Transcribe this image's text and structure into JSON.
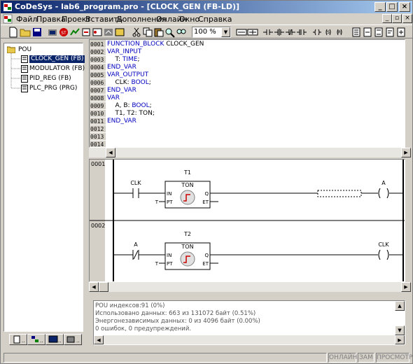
{
  "window": {
    "title": "CoDeSys - lab6_program.pro - [CLOCK_GEN (FB-LD)]",
    "controls": [
      "_",
      "□",
      "×"
    ]
  },
  "menu": [
    "Файл",
    "Правка",
    "Проект",
    "Вставить",
    "Дополнения",
    "Онлайн",
    "Окно",
    "Справка"
  ],
  "toolbar": {
    "zoom": "100 %"
  },
  "tree": {
    "root": "POU",
    "items": [
      {
        "label": "CLOCK_GEN (FB)",
        "selected": true
      },
      {
        "label": "MODULATOR (FB)",
        "selected": false
      },
      {
        "label": "PID_REG (FB)",
        "selected": false
      },
      {
        "label": "PLC_PRG (PRG)",
        "selected": false
      }
    ]
  },
  "declaration": {
    "line_numbers": [
      "0001",
      "0002",
      "0003",
      "0004",
      "0005",
      "0006",
      "0007",
      "0008",
      "0009",
      "0010",
      "0011",
      "0012",
      "0013",
      "0014"
    ],
    "lines": [
      {
        "kw": "FUNCTION_BLOCK",
        "rest": " CLOCK_GEN"
      },
      {
        "kw": "VAR_INPUT",
        "rest": ""
      },
      {
        "kw": "",
        "rest": "    T: ",
        "kw2": "TIME",
        "tail": ";"
      },
      {
        "kw": "END_VAR",
        "rest": ""
      },
      {
        "kw": "VAR_OUTPUT",
        "rest": ""
      },
      {
        "kw": "",
        "rest": "    CLK: ",
        "kw2": "BOOL",
        "tail": ";"
      },
      {
        "kw": "END_VAR",
        "rest": ""
      },
      {
        "kw": "VAR",
        "rest": ""
      },
      {
        "kw": "",
        "rest": "    A, B: ",
        "kw2": "BOOL",
        "tail": ";"
      },
      {
        "kw": "",
        "rest": "    T1, T2: TON;"
      },
      {
        "kw": "END_VAR",
        "rest": ""
      }
    ]
  },
  "ladder": {
    "networks": [
      {
        "number": "0001",
        "contact_label": "CLK",
        "timer_name": "T1",
        "timer_type": "TON",
        "in": "IN",
        "pt": "PT",
        "q": "Q",
        "et": "ET",
        "pt_input": "T",
        "coil_label": "A",
        "negated_contact": false
      },
      {
        "number": "0002",
        "contact_label": "A",
        "timer_name": "T2",
        "timer_type": "TON",
        "in": "IN",
        "pt": "PT",
        "q": "Q",
        "et": "ET",
        "pt_input": "T",
        "coil_label": "CLK",
        "negated_contact": true
      }
    ]
  },
  "messages": [
    "POU индексов:91 (0%)",
    "Использовано данных: 663 из 131072 байт (0.51%)",
    "Энергонезависимых данных: 0 из 4096 байт (0.00%)",
    "0 ошибок, 0 предупреждений."
  ],
  "status": [
    "ОНЛАЙН",
    "ЗАМ",
    "ПРОСМОТР"
  ]
}
